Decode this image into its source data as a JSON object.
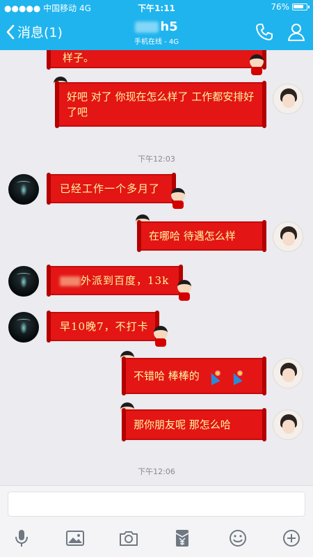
{
  "status_bar": {
    "carrier": "●●●●● 中国移动  4G",
    "time": "下午1:11",
    "battery": "76%"
  },
  "header": {
    "back_label": "消息(1)",
    "title_suffix": "h5",
    "subtitle": "手机在线 - 4G"
  },
  "messages": [
    {
      "side": "right",
      "text": "样子。"
    },
    {
      "side": "right",
      "text": "好吧 对了 你现在怎么样了 工作都安排好了吧"
    },
    {
      "side": "timestamp",
      "text": "下午12:03"
    },
    {
      "side": "left",
      "text": "已经工作一个多月了"
    },
    {
      "side": "right",
      "text": "在哪哈 待遇怎么样"
    },
    {
      "side": "left",
      "text": "外派到百度，13k"
    },
    {
      "side": "left",
      "text": "早10晚7，不打卡"
    },
    {
      "side": "right",
      "text": "不错哈 棒棒的"
    },
    {
      "side": "right",
      "text": "那你朋友呢 那怎么哈"
    },
    {
      "side": "timestamp",
      "text": "下午12:06"
    }
  ],
  "input": {
    "placeholder": ""
  },
  "toolbar": [
    "microphone-icon",
    "image-icon",
    "camera-icon",
    "red-packet-icon",
    "emoji-icon",
    "plus-icon"
  ],
  "colors": {
    "header": "#1fb4ee",
    "bubble": "#e31515",
    "bubble_text": "#fff6a0",
    "background": "#ebebf0"
  }
}
